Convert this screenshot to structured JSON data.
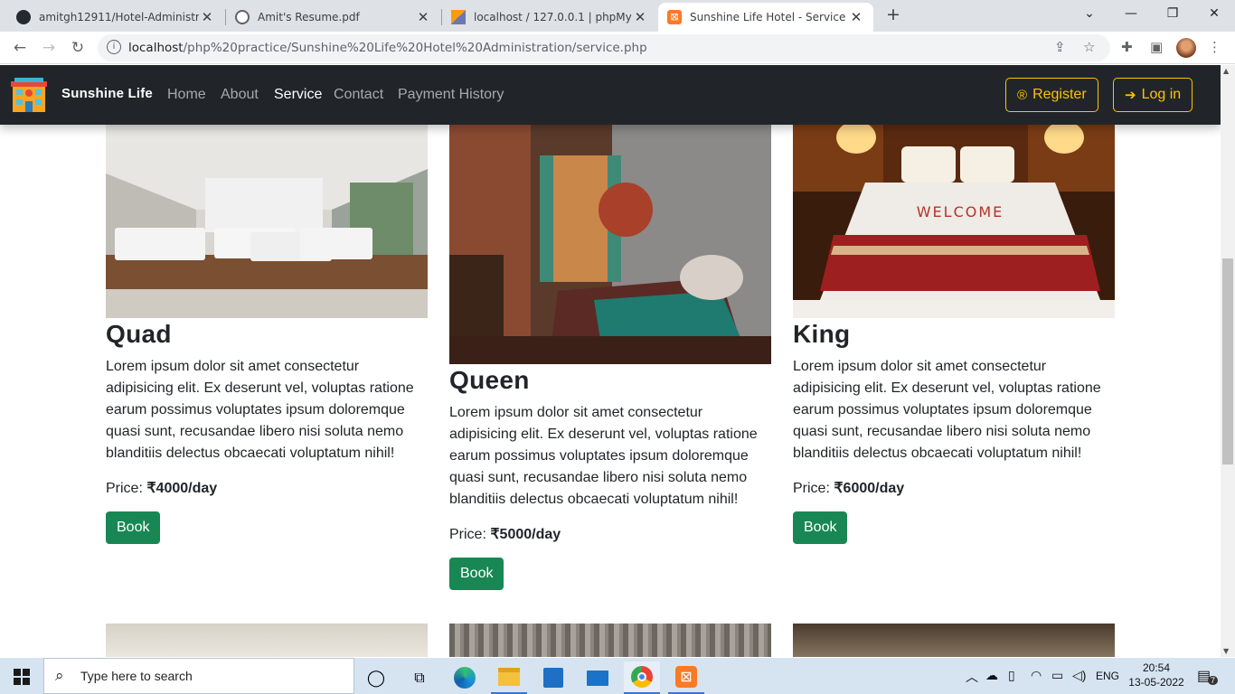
{
  "browser": {
    "tabs": [
      {
        "label": "amitgh12911/Hotel-Administratio",
        "icon": "github-icon"
      },
      {
        "label": "Amit's Resume.pdf",
        "icon": "globe-icon"
      },
      {
        "label": "localhost / 127.0.0.1 | phpMyAdm",
        "icon": "phpmyadmin-icon"
      },
      {
        "label": "Sunshine Life Hotel - Service",
        "icon": "xampp-icon",
        "active": true
      }
    ],
    "url_host": "localhost",
    "url_path": "/php%20practice/Sunshine%20Life%20Hotel%20Administration/service.php"
  },
  "navbar": {
    "brand": "Sunshine Life",
    "links": [
      "Home",
      "About",
      "Service",
      "Contact",
      "Payment History"
    ],
    "active": "Service",
    "register_label": "Register",
    "login_label": "Log in"
  },
  "rooms": [
    {
      "title": "Quad",
      "text": "Lorem ipsum dolor sit amet consectetur adipisicing elit. Ex deserunt vel, voluptas ratione earum possimus voluptates ipsum doloremque quasi sunt, recusandae libero nisi soluta nemo blanditiis delectus obcaecati voluptatum nihil!",
      "price_label": "Price:",
      "price": "₹4000/day",
      "button": "Book"
    },
    {
      "title": "Queen",
      "text": "Lorem ipsum dolor sit amet consectetur adipisicing elit. Ex deserunt vel, voluptas ratione earum possimus voluptates ipsum doloremque quasi sunt, recusandae libero nisi soluta nemo blanditiis delectus obcaecati voluptatum nihil!",
      "price_label": "Price:",
      "price": "₹5000/day",
      "button": "Book"
    },
    {
      "title": "King",
      "text": "Lorem ipsum dolor sit amet consectetur adipisicing elit. Ex deserunt vel, voluptas ratione earum possimus voluptates ipsum doloremque quasi sunt, recusandae libero nisi soluta nemo blanditiis delectus obcaecati voluptatum nihil!",
      "price_label": "Price:",
      "price": "₹6000/day",
      "button": "Book"
    }
  ],
  "king_image_text": "WELCOME",
  "taskbar": {
    "search_placeholder": "Type here to search",
    "language": "ENG",
    "time": "20:54",
    "date": "13-05-2022",
    "notification_count": "7"
  },
  "colors": {
    "book": "#198754",
    "navbar": "#212529",
    "accent": "#ffc107"
  }
}
